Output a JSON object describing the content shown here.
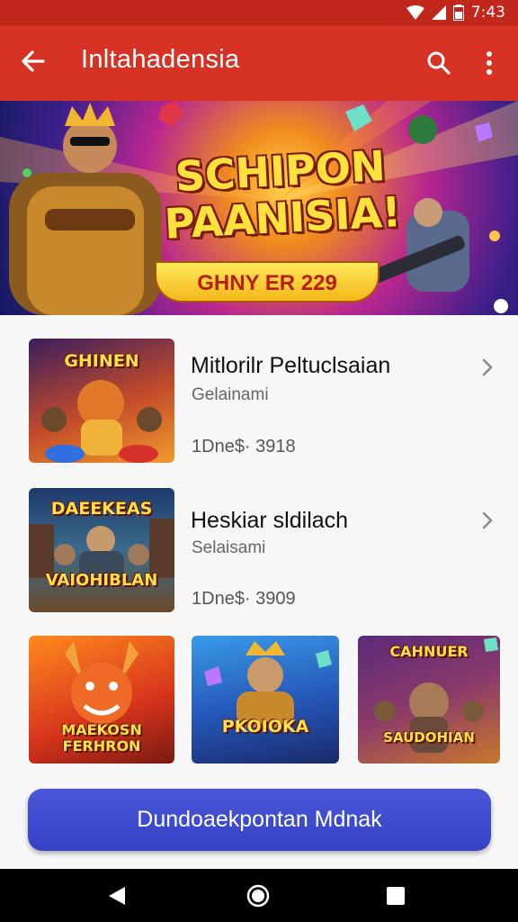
{
  "status_bar": {
    "time": "7:43"
  },
  "app_bar": {
    "title": "Inltahadensia"
  },
  "banner": {
    "headline_line1": "SCHIPON",
    "headline_line2": "PAANISIA!",
    "subline": "GHNY ER 229"
  },
  "list": [
    {
      "title": "Mitlorilr Peltuclsaian",
      "subtitle": "Gelainami",
      "meta": "1Dne$· 3918",
      "thumb_label": "GHINEN"
    },
    {
      "title": "Heskiar sldilach",
      "subtitle": "Selaisami",
      "meta": "1Dne$· 3909",
      "thumb_label_top": "DAEEKEAS",
      "thumb_label_bottom": "VAIOHIBLAN"
    }
  ],
  "grid": [
    {
      "label_line1": "MAEKOSN",
      "label_line2": "FERHRON"
    },
    {
      "label_line1": "PKOIOKA"
    },
    {
      "label_line1": "CAHNUER",
      "label_line2": "SAUDOHIAN"
    }
  ],
  "cta": {
    "label": "Dundoaekpontan Mdnak"
  },
  "colors": {
    "app_bar": "#d73324",
    "status_bar": "#c1271b",
    "cta": "#3d4bd0"
  },
  "icons": [
    "back-arrow-icon",
    "search-icon",
    "more-vert-icon",
    "chevron-right-icon",
    "nav-back-icon",
    "nav-home-icon",
    "nav-recents-icon"
  ]
}
